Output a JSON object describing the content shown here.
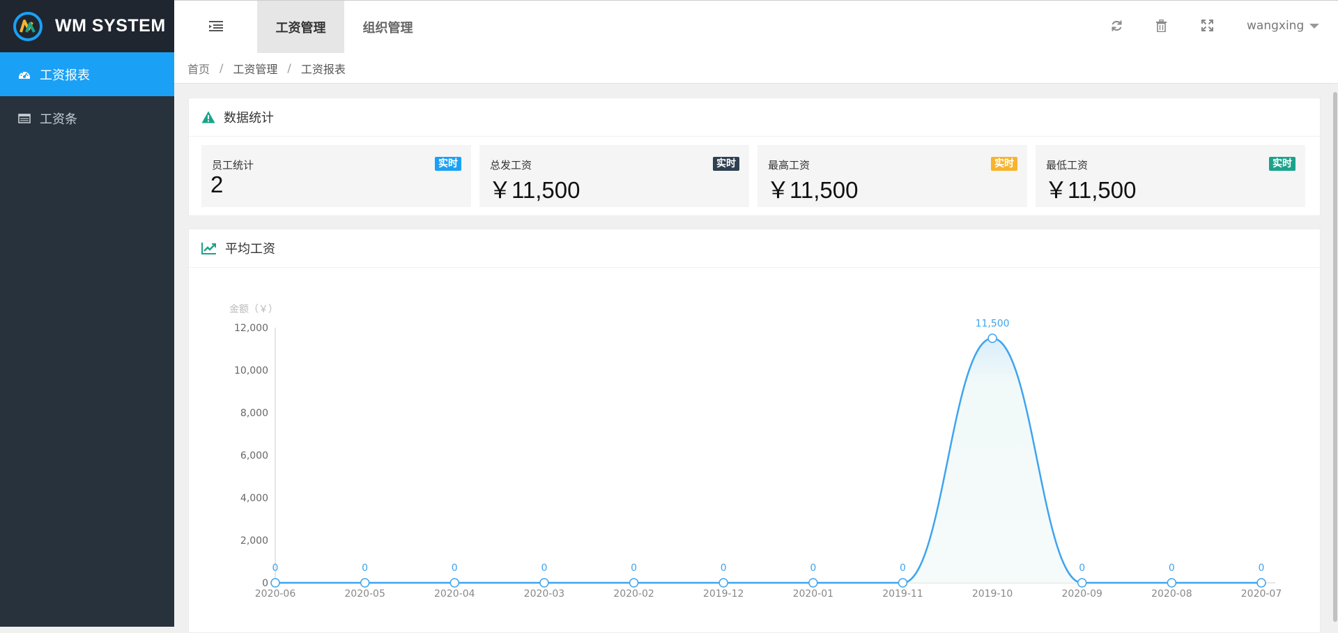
{
  "app": {
    "logo_text": "WM SYSTEM"
  },
  "sidebar": {
    "items": [
      {
        "label": "工资报表",
        "icon": "dashboard-icon",
        "active": true
      },
      {
        "label": "工资条",
        "icon": "table-icon",
        "active": false
      }
    ]
  },
  "header": {
    "tabs": [
      {
        "label": "工资管理",
        "active": true
      },
      {
        "label": "组织管理",
        "active": false
      }
    ],
    "username": "wangxing"
  },
  "breadcrumb": [
    "首页",
    "工资管理",
    "工资报表"
  ],
  "stats_panel": {
    "title": "数据统计",
    "badge_label": "实时",
    "cards": [
      {
        "label": "员工统计",
        "value": "2",
        "badge_color": "#1aa1f5"
      },
      {
        "label": "总发工资",
        "value": "￥11,500",
        "badge_color": "#2f4050"
      },
      {
        "label": "最高工资",
        "value": "￥11,500",
        "badge_color": "#f7b42c"
      },
      {
        "label": "最低工资",
        "value": "￥11,500",
        "badge_color": "#1aa38a"
      }
    ]
  },
  "chart_panel": {
    "title": "平均工资"
  },
  "colors": {
    "accent": "#1aa1f5",
    "line": "#3ea4ef",
    "sidebar_bg": "#28323d",
    "teal_icon": "#1aa38a"
  },
  "chart_data": {
    "type": "line",
    "smooth": true,
    "area": true,
    "ylabel": "金额（￥）",
    "ylim": [
      0,
      12000
    ],
    "yticks": [
      "0",
      "2,000",
      "4,000",
      "6,000",
      "8,000",
      "10,000",
      "12,000"
    ],
    "x": [
      "2020-06",
      "2020-05",
      "2020-04",
      "2020-03",
      "2020-02",
      "2019-12",
      "2020-01",
      "2019-11",
      "2019-10",
      "2020-09",
      "2020-08",
      "2020-07"
    ],
    "values": [
      0,
      0,
      0,
      0,
      0,
      0,
      0,
      0,
      11500,
      0,
      0,
      0
    ],
    "data_labels": [
      "0",
      "0",
      "0",
      "0",
      "0",
      "0",
      "0",
      "0",
      "11,500",
      "0",
      "0",
      "0"
    ],
    "grid": false,
    "legend": "none"
  }
}
